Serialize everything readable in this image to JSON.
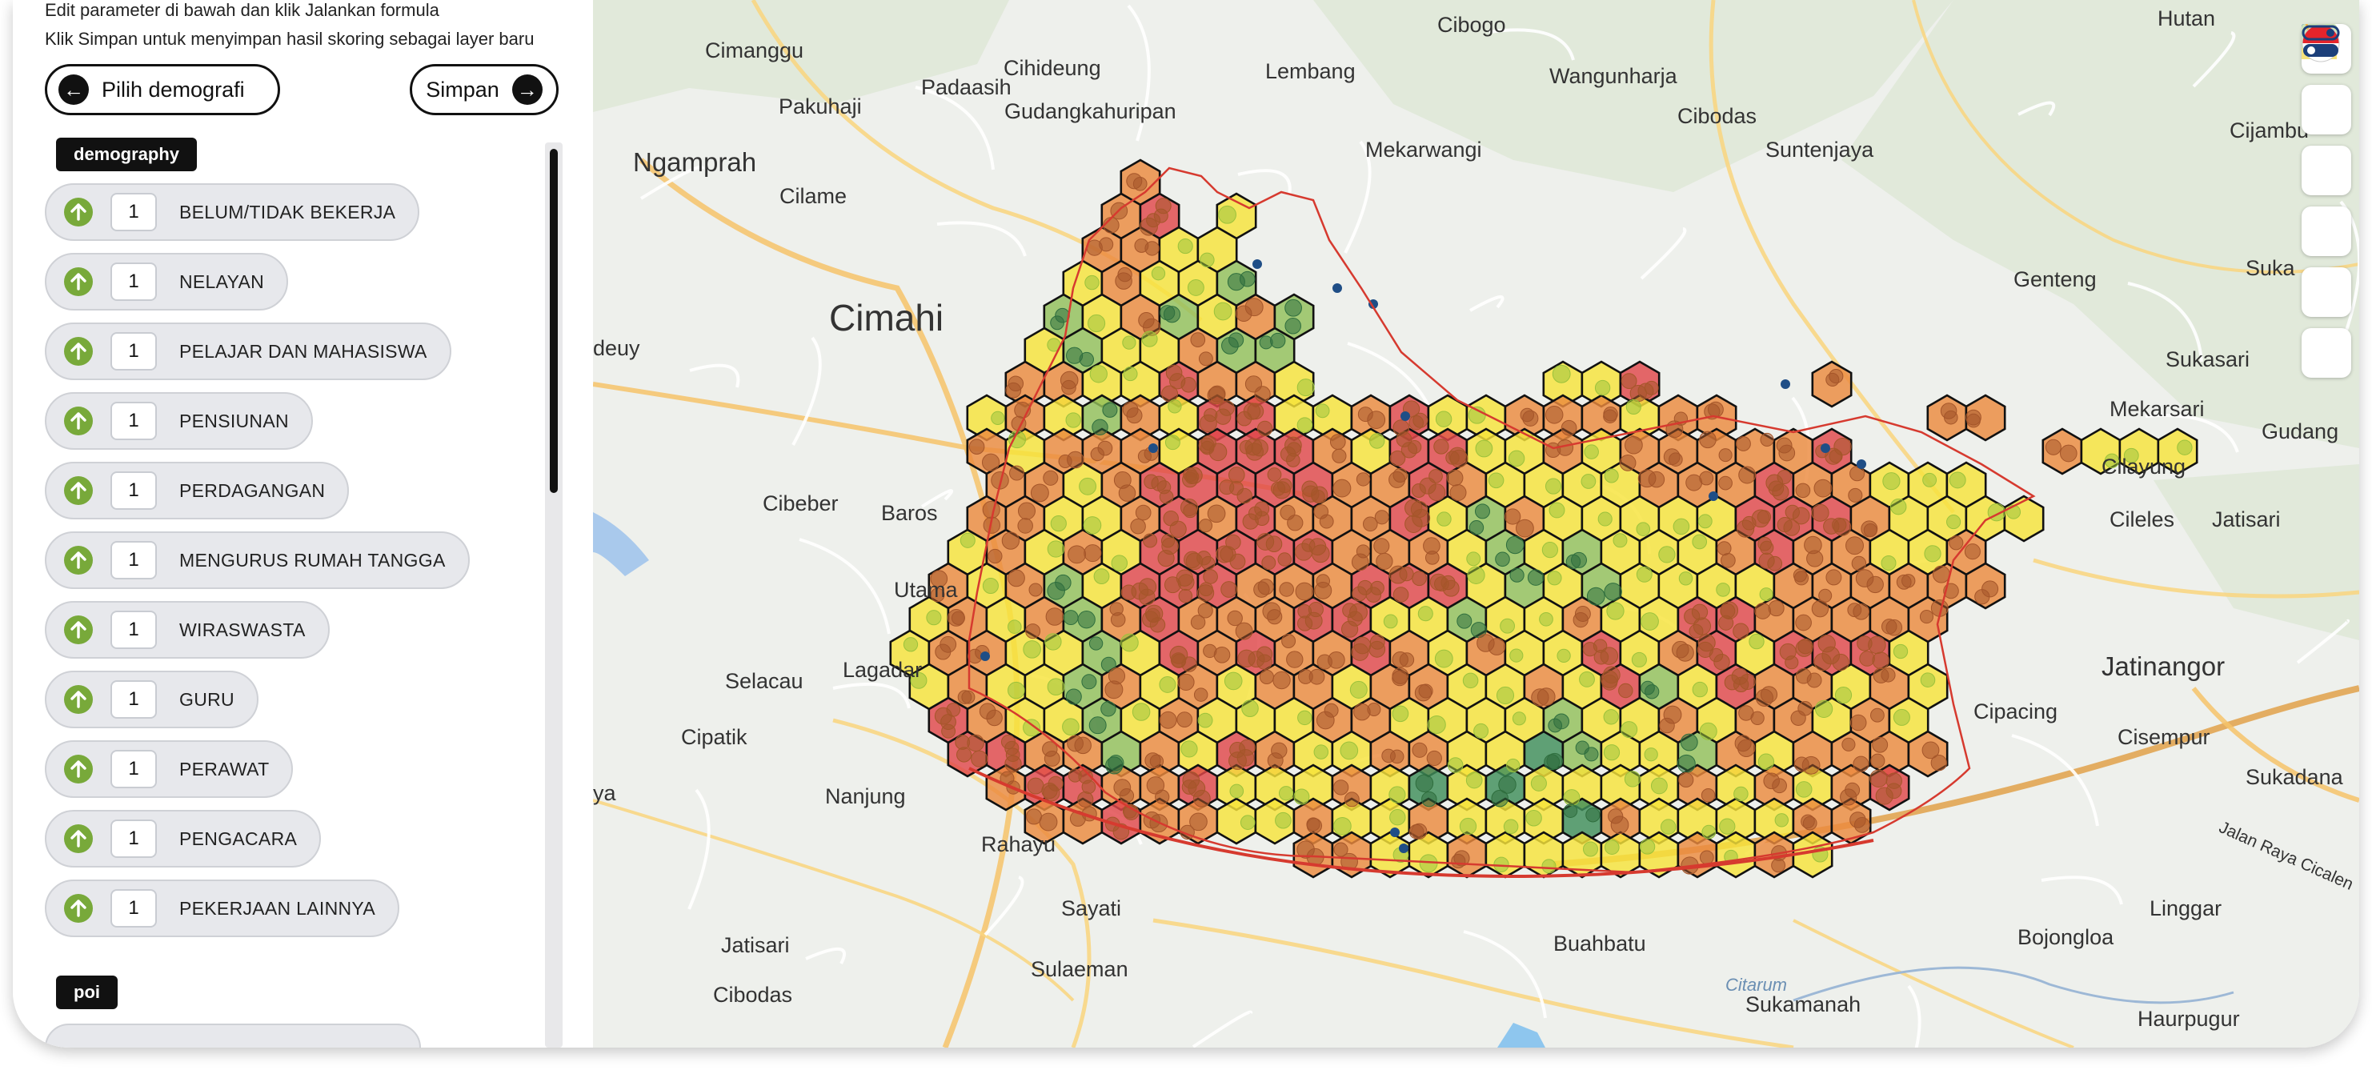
{
  "panel": {
    "hint_edit": "Edit parameter di bawah dan klik Jalankan formula",
    "hint_save": "Klik Simpan untuk menyimpan hasil skoring sebagai layer baru",
    "back_label": "Pilih demografi",
    "save_label": "Simpan"
  },
  "categories": [
    {
      "name": "demography",
      "items": [
        {
          "weight": "1",
          "label": "BELUM/TIDAK BEKERJA"
        },
        {
          "weight": "1",
          "label": "NELAYAN"
        },
        {
          "weight": "1",
          "label": "PELAJAR DAN MAHASISWA"
        },
        {
          "weight": "1",
          "label": "PENSIUNAN"
        },
        {
          "weight": "1",
          "label": "PERDAGANGAN"
        },
        {
          "weight": "1",
          "label": "MENGURUS RUMAH TANGGA"
        },
        {
          "weight": "1",
          "label": "WIRASWASTA"
        },
        {
          "weight": "1",
          "label": "GURU"
        },
        {
          "weight": "1",
          "label": "PERAWAT"
        },
        {
          "weight": "1",
          "label": "PENGACARA"
        },
        {
          "weight": "1",
          "label": "PEKERJAAN LAINNYA"
        }
      ]
    },
    {
      "name": "poi",
      "items": []
    }
  ],
  "map": {
    "places": {
      "cibogo": "Cibogo",
      "hutan": "Hutan",
      "cimanggu": "Cimanggu",
      "cihideung": "Cihideung",
      "lembang": "Lembang",
      "wangunharja": "Wangunharja",
      "pakuhaji": "Pakuhaji",
      "padaasih": "Padaasih",
      "gudangkahuripan": "Gudangkahuripan",
      "cibodas_n": "Cibodas",
      "cijambu": "Cijambu",
      "ngamprah": "Ngamprah",
      "mekarwangi": "Mekarwangi",
      "suntenjaya": "Suntenjaya",
      "cilame": "Cilame",
      "cimahi": "Cimahi",
      "genteng": "Genteng",
      "suka": "Suka",
      "deuy": "deuy",
      "sukasari": "Sukasari",
      "mekarsari": "Mekarsari",
      "gudang": "Gudang",
      "cibeber": "Cibeber",
      "baros": "Baros",
      "cilayung": "Cilayung",
      "cileles": "Cileles",
      "jatisari_e": "Jatisari",
      "utama": "Utama",
      "selacau": "Selacau",
      "lagadar": "Lagadar",
      "jatinangor": "Jatinangor",
      "cipacing": "Cipacing",
      "cipatik": "Cipatik",
      "cisempur": "Cisempur",
      "ya": "ya",
      "nanjung": "Nanjung",
      "sukadana": "Sukadana",
      "rahayu": "Rahayu",
      "sayati": "Sayati",
      "linggar": "Linggar",
      "jatisari_w": "Jatisari",
      "buahbatu": "Buahbatu",
      "bojongloa": "Bojongloa",
      "sulaeman": "Sulaeman",
      "cibodas_s": "Cibodas",
      "sukamanah": "Sukamanah",
      "haurpugur": "Haurpugur",
      "citarum": "Citarum",
      "jalan_raya": "Jalan Raya Cicalen"
    }
  },
  "toolbar": {
    "icons": [
      "locate-icon",
      "ruler-icon",
      "legend-list-icon",
      "basemap-icon",
      "flag-indonesia-icon",
      "toggle-layers-icon"
    ]
  },
  "colors": {
    "score_high": "#e0474b",
    "score_mid_high": "#eb8a3e",
    "score_mid": "#f7e33b",
    "score_low": "#93c05a",
    "score_lowest": "#3f8d5a",
    "accent_green": "#78a93a"
  }
}
